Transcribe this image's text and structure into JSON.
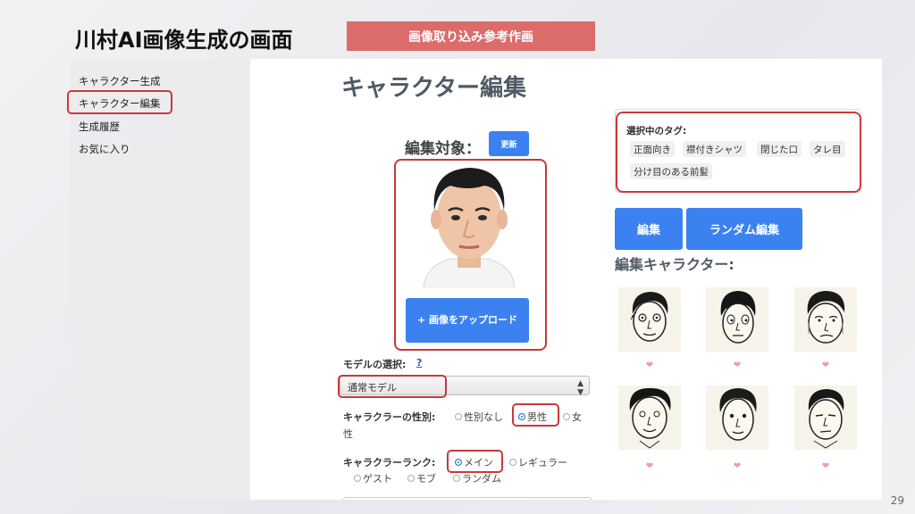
{
  "slide": {
    "title": "川村AI画像生成の画面",
    "banner": "画像取り込み参考作画",
    "page_number": "29"
  },
  "sidebar": {
    "items": [
      {
        "label": "キャラクター生成"
      },
      {
        "label": "キャラクター編集"
      },
      {
        "label": "生成履歴"
      },
      {
        "label": "お気に入り"
      }
    ]
  },
  "main": {
    "heading": "キャラクター編集",
    "edit_target_label": "編集対象：",
    "update_button": "更新",
    "upload_button": "+ 画像をアップロード",
    "model_label": "モデルの選択:",
    "model_help": "?",
    "model_value": "通常モデル",
    "gender_label": "キャラクラーの性別:",
    "gender_options": [
      "性別なし",
      "男性",
      "女性"
    ],
    "gender_selected": "男性",
    "rank_label": "キャラクラーランク:",
    "rank_options": [
      "メイン",
      "レギュラー",
      "ゲスト",
      "モブ",
      "ランダム"
    ],
    "rank_selected": "メイン"
  },
  "tags": {
    "title": "選択中のタグ:",
    "items": [
      "正面向き",
      "襟付きシャツ",
      "閉じた口",
      "タレ目",
      "分け目のある前髪"
    ]
  },
  "actions": {
    "edit_button": "編集",
    "random_edit_button": "ランダム編集"
  },
  "characters": {
    "title": "編集キャラクター:",
    "favorite_icon": "heart-icon",
    "count": 6
  },
  "colors": {
    "accent_blue": "#3b82f0",
    "highlight_red": "#c8393b",
    "banner_red": "#dc6b6b"
  }
}
